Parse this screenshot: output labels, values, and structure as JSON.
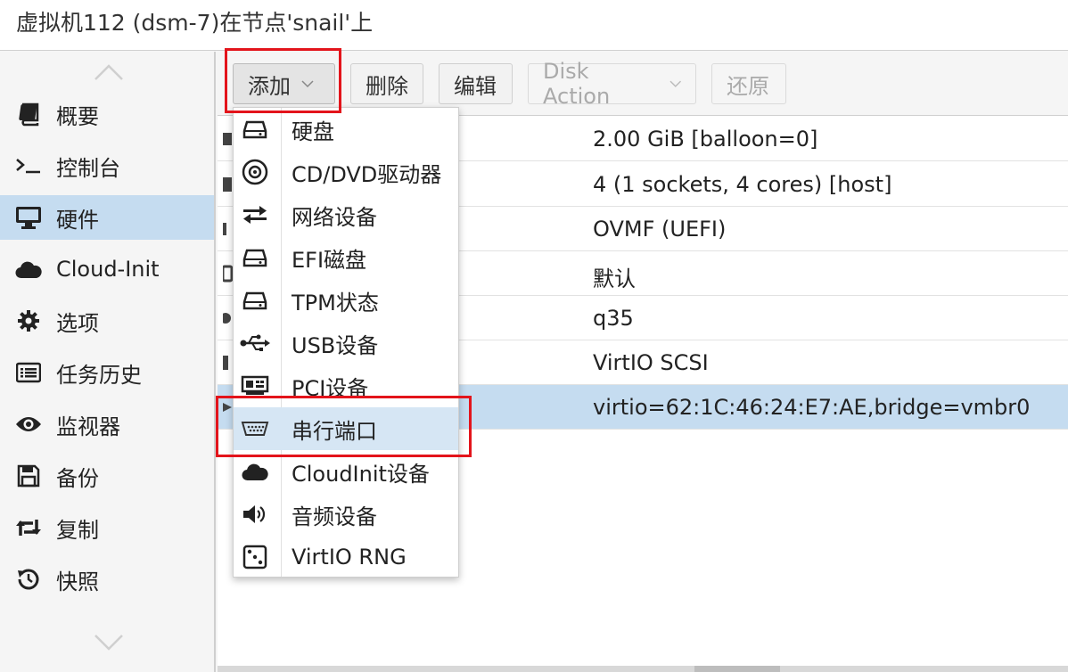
{
  "window": {
    "title": "虚拟机112 (dsm-7)在节点'snail'上"
  },
  "sidebar": {
    "items": [
      {
        "label": "概要",
        "icon": "book-icon"
      },
      {
        "label": "控制台",
        "icon": "terminal-icon"
      },
      {
        "label": "硬件",
        "icon": "desktop-icon",
        "selected": true
      },
      {
        "label": "Cloud-Init",
        "icon": "cloud-icon"
      },
      {
        "label": "选项",
        "icon": "gear-icon"
      },
      {
        "label": "任务历史",
        "icon": "list-icon"
      },
      {
        "label": "监视器",
        "icon": "eye-icon"
      },
      {
        "label": "备份",
        "icon": "floppy-icon"
      },
      {
        "label": "复制",
        "icon": "retweet-icon"
      },
      {
        "label": "快照",
        "icon": "history-icon"
      }
    ]
  },
  "toolbar": {
    "add_label": "添加",
    "delete_label": "删除",
    "edit_label": "编辑",
    "disk_action_label": "Disk Action",
    "revert_label": "还原"
  },
  "hardware_rows": [
    {
      "value": "2.00 GiB [balloon=0]"
    },
    {
      "value": "4 (1 sockets, 4 cores) [host]"
    },
    {
      "value": "OVMF (UEFI)"
    },
    {
      "value": "默认"
    },
    {
      "value": "q35"
    },
    {
      "value": "VirtIO SCSI"
    },
    {
      "value": "virtio=62:1C:46:24:E7:AE,bridge=vmbr0",
      "selected": true
    }
  ],
  "add_menu": {
    "items": [
      {
        "label": "硬盘",
        "icon": "hdd-icon"
      },
      {
        "label": "CD/DVD驱动器",
        "icon": "cdrom-icon"
      },
      {
        "label": "网络设备",
        "icon": "exchange-icon"
      },
      {
        "label": "EFI磁盘",
        "icon": "hdd-icon"
      },
      {
        "label": "TPM状态",
        "icon": "hdd-icon"
      },
      {
        "label": "USB设备",
        "icon": "usb-icon"
      },
      {
        "label": "PCI设备",
        "icon": "pci-card-icon"
      },
      {
        "label": "串行端口",
        "icon": "serial-port-icon",
        "active": true
      },
      {
        "label": "CloudInit设备",
        "icon": "cloud-icon"
      },
      {
        "label": "音频设备",
        "icon": "volume-icon"
      },
      {
        "label": "VirtIO RNG",
        "icon": "dice-icon"
      }
    ]
  },
  "colors": {
    "selection": "#c5dcf0",
    "menu_hover": "#d6e6f4",
    "annotation_red": "#e3141b"
  }
}
